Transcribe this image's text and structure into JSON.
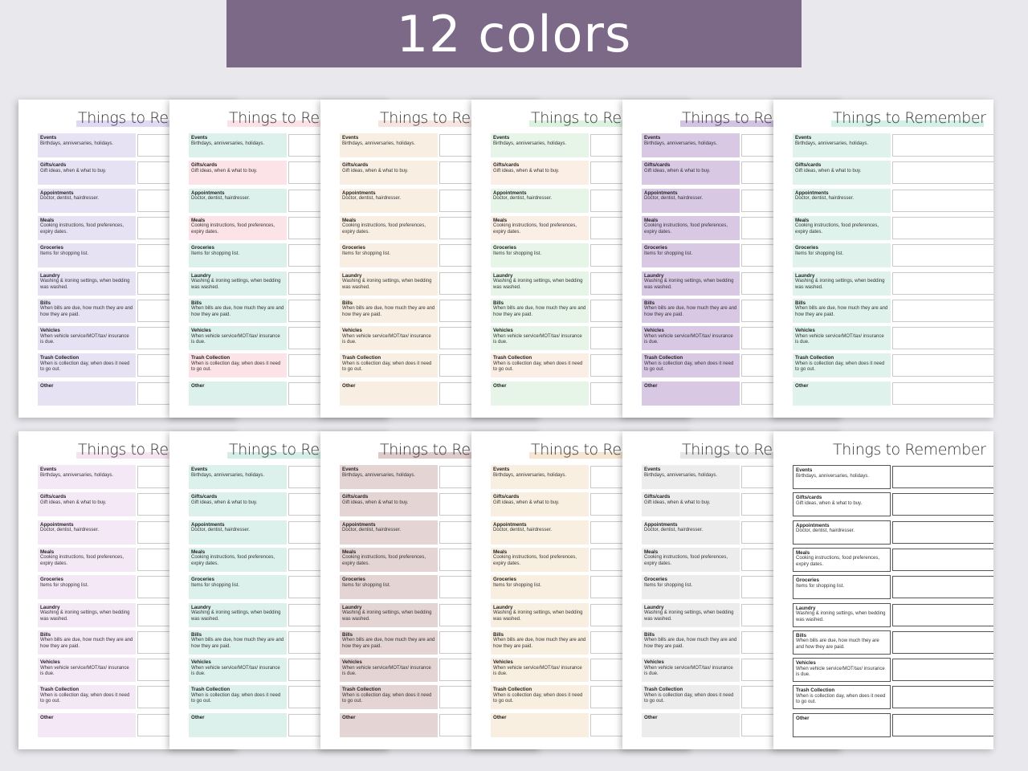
{
  "banner": {
    "text": "12 colors"
  },
  "page_title": "Things to Remember",
  "rows": [
    {
      "title": "Events",
      "desc": "Birthdays, anniversaries, holidays."
    },
    {
      "title": "Gifts/cards",
      "desc": "Gift ideas, when & what to buy."
    },
    {
      "title": "Appointments",
      "desc": "Doctor, dentist, hairdresser."
    },
    {
      "title": "Meals",
      "desc": "Cooking instructions, food preferences, expiry dates."
    },
    {
      "title": "Groceries",
      "desc": "Items for shopping list."
    },
    {
      "title": "Laundry",
      "desc": "Washing & ironing settings, when bedding was washed."
    },
    {
      "title": "Bills",
      "desc": "When bills are due, how much they are and how they are paid."
    },
    {
      "title": "Vehicles",
      "desc": "When vehicle service/MOT/tax/ insurance is due."
    },
    {
      "title": "Trash Collection",
      "desc": "When is collection day, when does it need to go out."
    },
    {
      "title": "Other",
      "desc": ""
    }
  ],
  "sheets": [
    {
      "color": "#e6e2f4",
      "accent": "#dcd5ef"
    },
    {
      "color": "#dcf0ec",
      "accent": "#f9dfe4",
      "alt": "#fbe3e8"
    },
    {
      "color": "#f8efe2",
      "accent": "#f4e1db"
    },
    {
      "color": "#e7f5e8",
      "accent": "#d8f1dc",
      "alt": "#fbeee5"
    },
    {
      "color": "#d8c8e4",
      "accent": "#cdbde0"
    },
    {
      "color": "#dff3ec",
      "accent": "#cdeee2"
    },
    {
      "color": "#f4e7f6",
      "accent": "#f5e0f0"
    },
    {
      "color": "#dcf1ec",
      "accent": "#cfece4"
    },
    {
      "color": "#e5d4d4",
      "accent": "#dbc4c4"
    },
    {
      "color": "#f8efe0",
      "accent": "#f5e2cc"
    },
    {
      "color": "#ececec",
      "accent": "#e2e2e2"
    },
    {
      "color": "#ffffff",
      "accent": "#ffffff",
      "lined": true
    }
  ]
}
